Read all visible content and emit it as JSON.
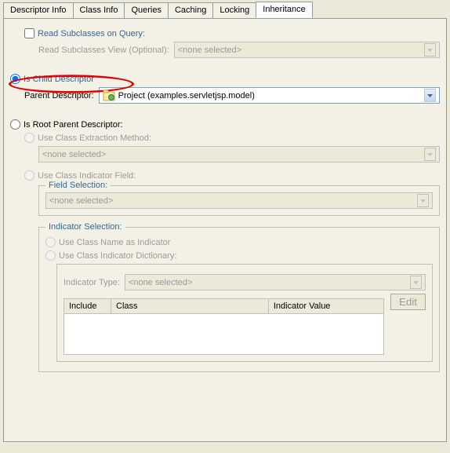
{
  "tabs": {
    "items": [
      "Descriptor Info",
      "Class Info",
      "Queries",
      "Caching",
      "Locking",
      "Inheritance"
    ],
    "active": "Inheritance"
  },
  "readSubclasses": {
    "checkbox_label": "Read Subclasses on Query:",
    "view_label": "Read Subclasses View (Optional):",
    "view_value": "<none selected>"
  },
  "isChild": {
    "radio_label": "Is Child Descriptor",
    "parent_label": "Parent Descriptor:",
    "parent_value": "Project (examples.servletjsp.model)"
  },
  "isRoot": {
    "radio_label": "Is Root Parent Descriptor:",
    "extraction_label": "Use Class Extraction Method:",
    "extraction_value": "<none selected>",
    "indicator_field_label": "Use Class Indicator Field:",
    "field_selection_legend": "Field Selection:",
    "field_selection_value": "<none selected>",
    "indicator_selection_legend": "Indicator Selection:",
    "use_class_name_label": "Use Class Name as Indicator",
    "use_dictionary_label": "Use Class Indicator Dictionary:",
    "indicator_type_label": "Indicator Type:",
    "indicator_type_value": "<none selected>",
    "table": {
      "col_include": "Include",
      "col_class": "Class",
      "col_iv": "Indicator Value"
    },
    "edit_btn": "Edit"
  }
}
